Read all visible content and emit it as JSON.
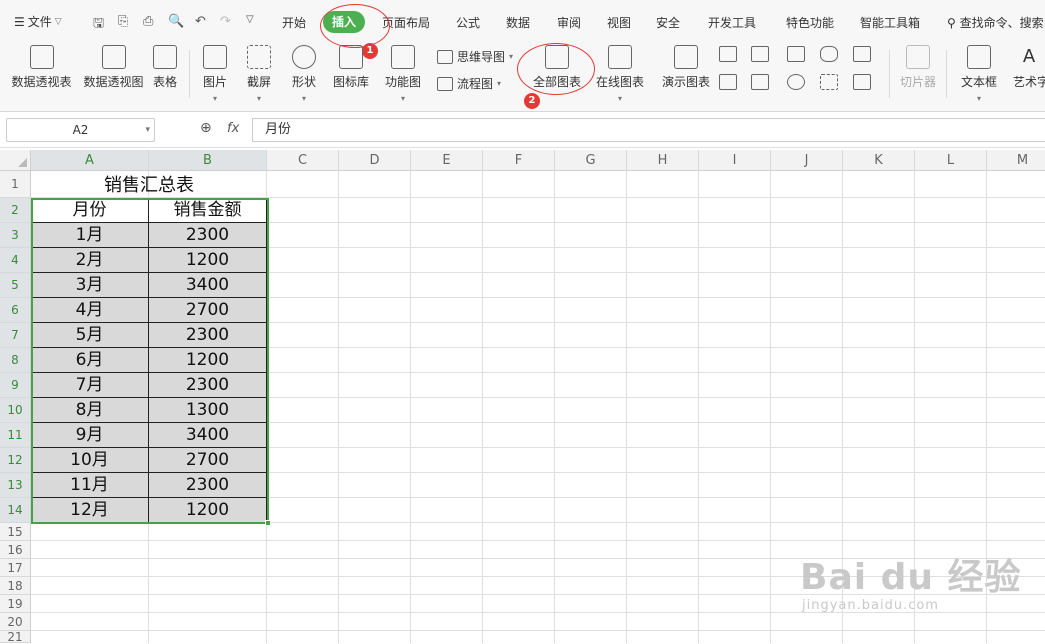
{
  "ribbon": {
    "file_menu": "文件",
    "tabs": [
      "开始",
      "插入",
      "页面布局",
      "公式",
      "数据",
      "审阅",
      "视图",
      "安全",
      "开发工具",
      "特色功能",
      "智能工具箱"
    ],
    "active_tab": "插入",
    "search_label": "查找命令、搜索",
    "tools": {
      "pivot_table": "数据透视表",
      "pivot_chart": "数据透视图",
      "table": "表格",
      "picture": "图片",
      "screenshot": "截屏",
      "shapes": "形状",
      "icon_library": "图标库",
      "function_chart": "功能图",
      "mind_map": "思维导图",
      "flowchart": "流程图",
      "all_charts": "全部图表",
      "online_charts": "在线图表",
      "demo_charts": "演示图表",
      "slicer": "切片器",
      "textbox": "文本框",
      "wordart": "艺术字"
    },
    "annotation_badges": [
      "1",
      "2"
    ]
  },
  "formula_bar": {
    "name_box": "A2",
    "fx_label": "fx",
    "value": "月份"
  },
  "sheet": {
    "columns": [
      "A",
      "B",
      "C",
      "D",
      "E",
      "F",
      "G",
      "H",
      "I",
      "J",
      "K",
      "L",
      "M"
    ],
    "rows": [
      "1",
      "2",
      "3",
      "4",
      "5",
      "6",
      "7",
      "8",
      "9",
      "10",
      "11",
      "12",
      "13",
      "14",
      "15",
      "16",
      "17",
      "18",
      "19",
      "20",
      "21"
    ],
    "title": "销售汇总表",
    "header": [
      "月份",
      "销售金额"
    ],
    "data": [
      [
        "1月",
        "2300"
      ],
      [
        "2月",
        "1200"
      ],
      [
        "3月",
        "3400"
      ],
      [
        "4月",
        "2700"
      ],
      [
        "5月",
        "2300"
      ],
      [
        "6月",
        "1200"
      ],
      [
        "7月",
        "2300"
      ],
      [
        "8月",
        "1300"
      ],
      [
        "9月",
        "3400"
      ],
      [
        "10月",
        "2700"
      ],
      [
        "11月",
        "2300"
      ],
      [
        "12月",
        "1200"
      ]
    ]
  },
  "watermark": {
    "main": "Bai du 经验",
    "sub": "jingyan.baidu.com"
  },
  "colors": {
    "accent_green": "#4caf50",
    "annotation_red": "#e53935",
    "selection_green": "#4a9f4a",
    "data_fill": "#d9d9d9"
  }
}
